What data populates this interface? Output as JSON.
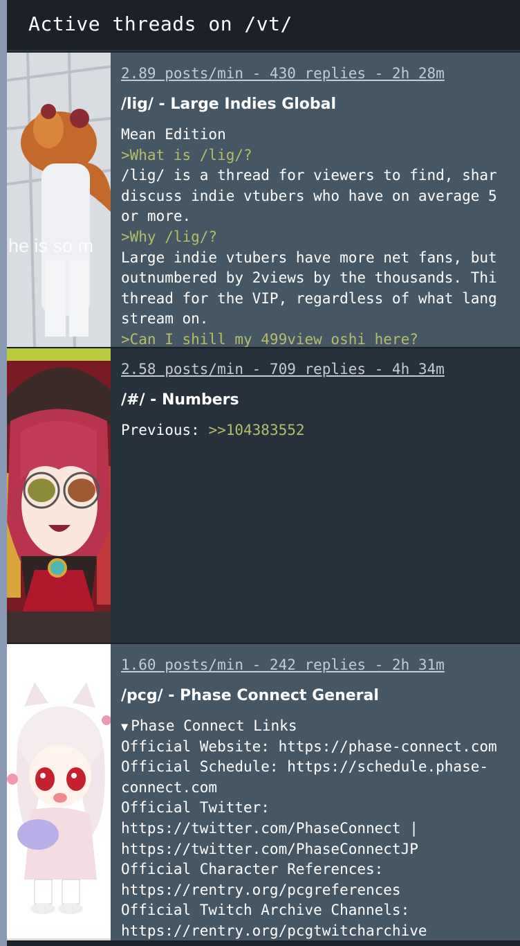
{
  "header": {
    "title": "Active threads on /vt/"
  },
  "threads": [
    {
      "stats": "2.89 posts/min - 430 replies - 2h 28m",
      "title": "/lig/ - Large Indies Global",
      "thumb_caption": "he is so m",
      "lines": [
        "Mean Edition",
        ">What is /lig/?",
        "/lig/ is a thread for viewers to find, shar",
        "discuss indie vtubers who have on average 5",
        "or more.",
        ">Why /lig/?",
        "Large indie vtubers have more net fans, but",
        "outnumbered by 2views by the thousands. Thi",
        "thread for the VIP, regardless of what lang",
        "stream on.",
        ">Can I shill my 499view oshi here?"
      ]
    },
    {
      "stats": "2.58 posts/min - 709 replies - 4h 34m",
      "title": "/#/ - Numbers",
      "previous_label": "Previous: ",
      "previous_link": ">>104383552"
    },
    {
      "stats": "1.60 posts/min - 242 replies - 2h 31m",
      "title": "/pcg/ - Phase Connect General",
      "summary_triangle": "▼",
      "summary": "Phase Connect Links",
      "lines": [
        "Official Website: https://phase-connect.com",
        "Official Schedule: https://schedule.phase-",
        "connect.com",
        "Official Twitter:",
        "https://twitter.com/PhaseConnect |",
        "https://twitter.com/PhaseConnectJP",
        "Official Character References:",
        "https://rentry.org/pcgreferences",
        "Official Twitch Archive Channels:",
        "https://rentry.org/pcgtwitcharchive"
      ]
    }
  ],
  "colors": {
    "background": "#1d232c",
    "thread_light": "#455764",
    "thread_dark": "#26313b",
    "greentext": "#b5bd68",
    "stats_text": "#c3cbd3"
  }
}
